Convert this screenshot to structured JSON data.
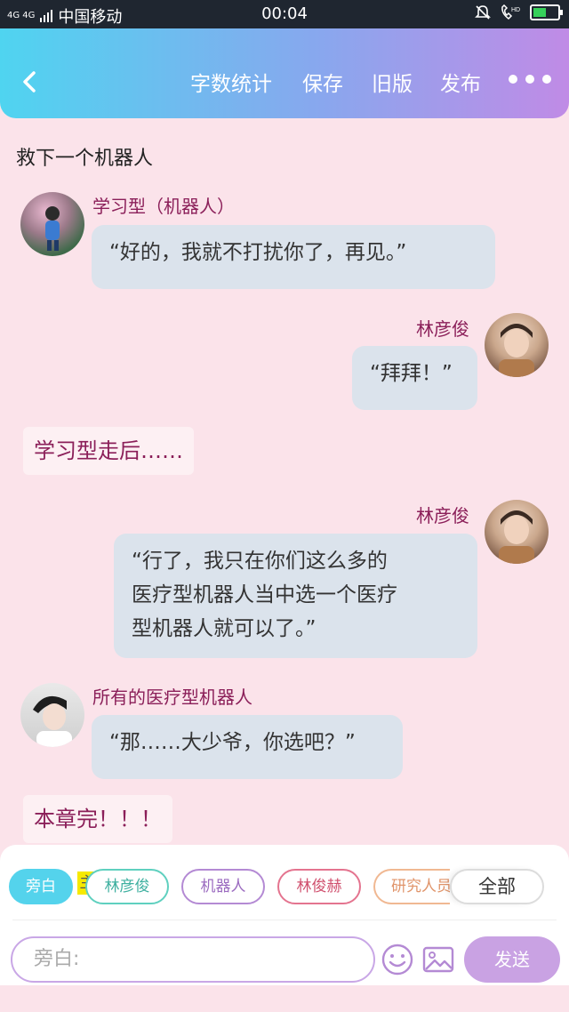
{
  "status_bar": {
    "network": "4G 4G",
    "carrier": "中国移动",
    "time": "00:04",
    "hd": "HD"
  },
  "header": {
    "word_count": "字数统计",
    "save": "保存",
    "old_version": "旧版",
    "publish": "发布"
  },
  "chapter_title": "救下一个机器人",
  "messages": [
    {
      "name": "学习型（机器人）",
      "text": "“好的，我就不打扰你了，再见。”"
    },
    {
      "name": "林彦俊",
      "text": "“拜拜！”"
    },
    {
      "narration": "学习型走后……"
    },
    {
      "name": "林彦俊",
      "line1": "“行了，我只在你们这么多的",
      "line2": "医疗型机器人当中选一个医疗",
      "line3": "型机器人就可以了。”"
    },
    {
      "name": "所有的医疗型机器人",
      "text": "“那……大少爷，你选吧？”"
    },
    {
      "narration": "本章完！！！"
    }
  ],
  "roles": {
    "narrator": "旁白",
    "main_tag": "主",
    "lin_yanjun": "林彦俊",
    "robot": "机器人",
    "lin_junhe": "林俊赫",
    "researcher": "研究人员",
    "all": "全部"
  },
  "composer": {
    "placeholder": "旁白:",
    "send": "发送"
  },
  "colors": {
    "accent": "#8b1f59",
    "header_start": "#4fd4f0",
    "header_end": "#c08be6",
    "bubble": "#dbe3ec"
  }
}
